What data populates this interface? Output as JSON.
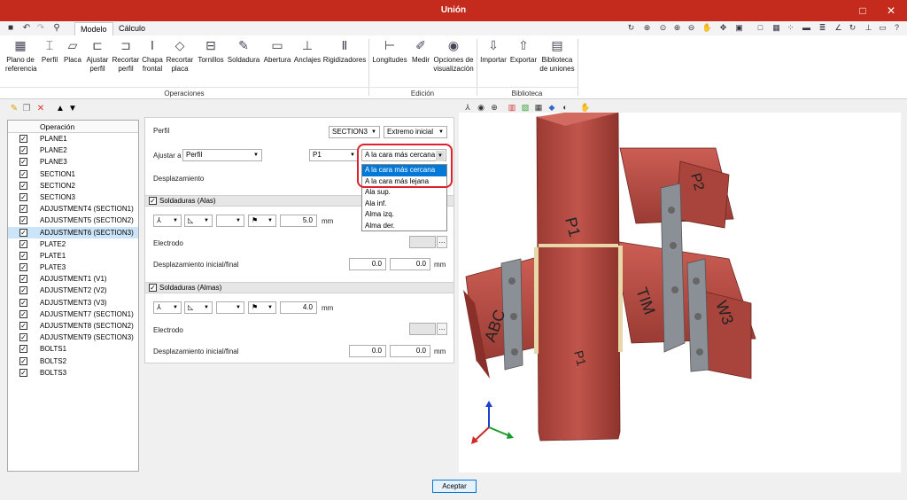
{
  "window": {
    "title": "Unión",
    "restore": "□",
    "close": "✕"
  },
  "tabs": [
    {
      "label": "Modelo"
    },
    {
      "label": "Cálculo"
    }
  ],
  "ribbon": {
    "buttons": [
      {
        "label": "Plano de referencia"
      },
      {
        "label": "Perfil"
      },
      {
        "label": "Placa"
      },
      {
        "label": "Ajustar perfil"
      },
      {
        "label": "Recortar perfil"
      },
      {
        "label": "Chapa frontal"
      },
      {
        "label": "Recortar placa"
      },
      {
        "label": "Tornillos"
      },
      {
        "label": "Soldadura"
      },
      {
        "label": "Abertura"
      },
      {
        "label": "Anclajes"
      },
      {
        "label": "Rigidizadores"
      },
      {
        "label": "Longitudes"
      },
      {
        "label": "Medir"
      },
      {
        "label": "Opciones de visualización"
      },
      {
        "label": "Importar"
      },
      {
        "label": "Exportar"
      },
      {
        "label": "Biblioteca de uniones"
      }
    ],
    "groups": [
      {
        "label": "Operaciones"
      },
      {
        "label": "Edición"
      },
      {
        "label": "Biblioteca"
      }
    ]
  },
  "operations": {
    "header": "Operación",
    "items": [
      "PLANE1",
      "PLANE2",
      "PLANE3",
      "SECTION1",
      "SECTION2",
      "SECTION3",
      "ADJUSTMENT4 (SECTION1)",
      "ADJUSTMENT5 (SECTION2)",
      "ADJUSTMENT6 (SECTION3)",
      "PLATE2",
      "PLATE1",
      "PLATE3",
      "ADJUSTMENT1 (V1)",
      "ADJUSTMENT2 (V2)",
      "ADJUSTMENT3 (V3)",
      "ADJUSTMENT7 (SECTION1)",
      "ADJUSTMENT8 (SECTION2)",
      "ADJUSTMENT9 (SECTION3)",
      "BOLTS1",
      "BOLTS2",
      "BOLTS3"
    ],
    "selected_index": 8
  },
  "form": {
    "perfil_label": "Perfil",
    "section_select": "SECTION3",
    "extremo_select": "Extremo inicial",
    "ajustar_label": "Ajustar a",
    "ajustar_select": "Perfil",
    "p_select": "P1",
    "cara_select": "A la cara más cercana",
    "desplazamiento_label": "Desplazamiento",
    "alas": {
      "title": "Soldaduras (Alas)",
      "value": "5.0",
      "unit": "mm",
      "electrodo": "Electrodo",
      "desp_label": "Desplazamiento inicial/final",
      "v1": "0.0",
      "v2": "0.0",
      "unit2": "mm"
    },
    "almas": {
      "title": "Soldaduras (Almas)",
      "value": "4.0",
      "unit": "mm",
      "electrodo": "Electrodo",
      "desp_label": "Desplazamiento inicial/final",
      "v1": "0.0",
      "v2": "0.0",
      "unit2": "mm"
    }
  },
  "dropdown": {
    "options": [
      "A la cara más cercana",
      "A la cara más lejana",
      "Ala sup.",
      "Ala inf.",
      "Alma izq.",
      "Alma der."
    ],
    "highlighted": 0
  },
  "model_labels": [
    "P1",
    "P2",
    "P1",
    "ABC",
    "TIM",
    "W3"
  ],
  "footer": {
    "accept": "Aceptar"
  },
  "colors": {
    "titlebar": "#c42b1c",
    "accent": "#0078d7",
    "steel": "#b5453c"
  }
}
